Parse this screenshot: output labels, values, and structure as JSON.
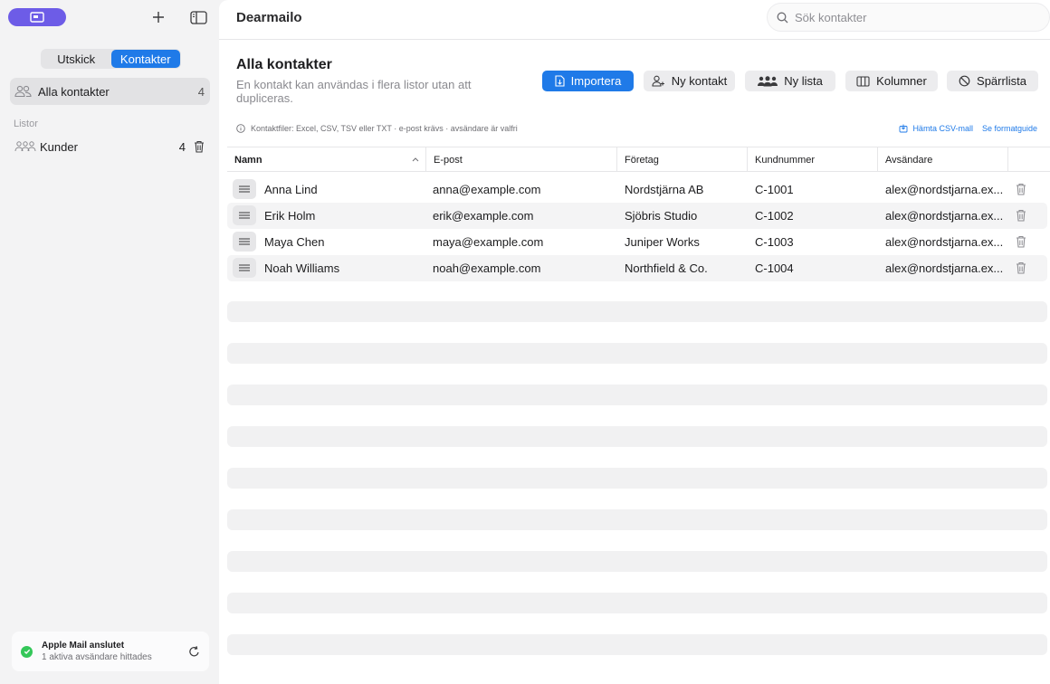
{
  "sidebar": {
    "segments": [
      "Utskick",
      "Kontakter"
    ],
    "active_segment": "Kontakter",
    "all_contacts": {
      "label": "Alla kontakter",
      "count": "4"
    },
    "lists_section": "Listor",
    "lists": [
      {
        "label": "Kunder",
        "count": "4"
      }
    ],
    "status": {
      "title": "Apple Mail anslutet",
      "subtitle": "1 aktiva avsändare hittades"
    }
  },
  "app": {
    "title": "Dearmailo"
  },
  "search": {
    "placeholder": "Sök kontakter"
  },
  "page": {
    "title": "Alla kontakter",
    "subtitle": "En kontakt kan användas i flera listor utan att dupliceras."
  },
  "toolbar": {
    "import": "Importera",
    "new_contact": "Ny kontakt",
    "new_list": "Ny lista",
    "columns": "Kolumner",
    "blocklist": "Spärrlista"
  },
  "hint": {
    "text": "Kontaktfiler: Excel, CSV, TSV eller TXT · e-post krävs · avsändare är valfri",
    "download_template": "Hämta CSV-mall",
    "format_guide": "Se formatguide"
  },
  "table": {
    "columns": [
      "Namn",
      "E-post",
      "Företag",
      "Kundnummer",
      "Avsändare"
    ],
    "rows": [
      {
        "name": "Anna Lind",
        "email": "anna@example.com",
        "company": "Nordstjärna AB",
        "customer_no": "C-1001",
        "sender": "alex@nordstjarna.ex..."
      },
      {
        "name": "Erik Holm",
        "email": "erik@example.com",
        "company": "Sjöbris Studio",
        "customer_no": "C-1002",
        "sender": "alex@nordstjarna.ex..."
      },
      {
        "name": "Maya Chen",
        "email": "maya@example.com",
        "company": "Juniper Works",
        "customer_no": "C-1003",
        "sender": "alex@nordstjarna.ex..."
      },
      {
        "name": "Noah Williams",
        "email": "noah@example.com",
        "company": "Northfield & Co.",
        "customer_no": "C-1004",
        "sender": "alex@nordstjarna.ex..."
      }
    ]
  },
  "colors": {
    "accent": "#1f7ae8",
    "brand": "#6d5ce7",
    "success": "#34c759"
  }
}
